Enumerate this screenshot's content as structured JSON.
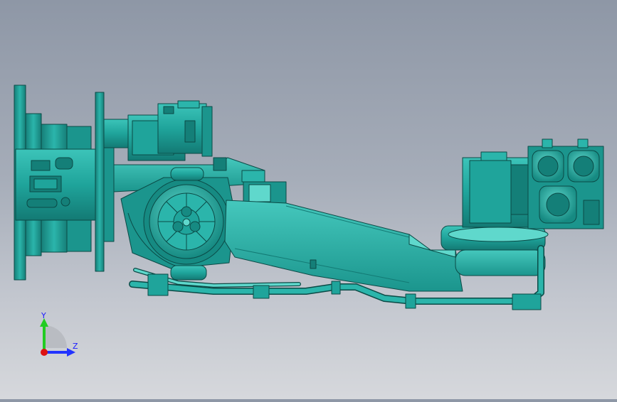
{
  "viewport": {
    "background_top": "#8e97a6",
    "background_bottom": "#d6d8dc",
    "model_color": "#1fa8a0",
    "model_edge_color": "#0b4a46"
  },
  "triad": {
    "y_label": "Y",
    "z_label": "Z",
    "y_axis_color": "#22cc22",
    "z_axis_color": "#2233ff",
    "origin_color": "#dd1111"
  }
}
